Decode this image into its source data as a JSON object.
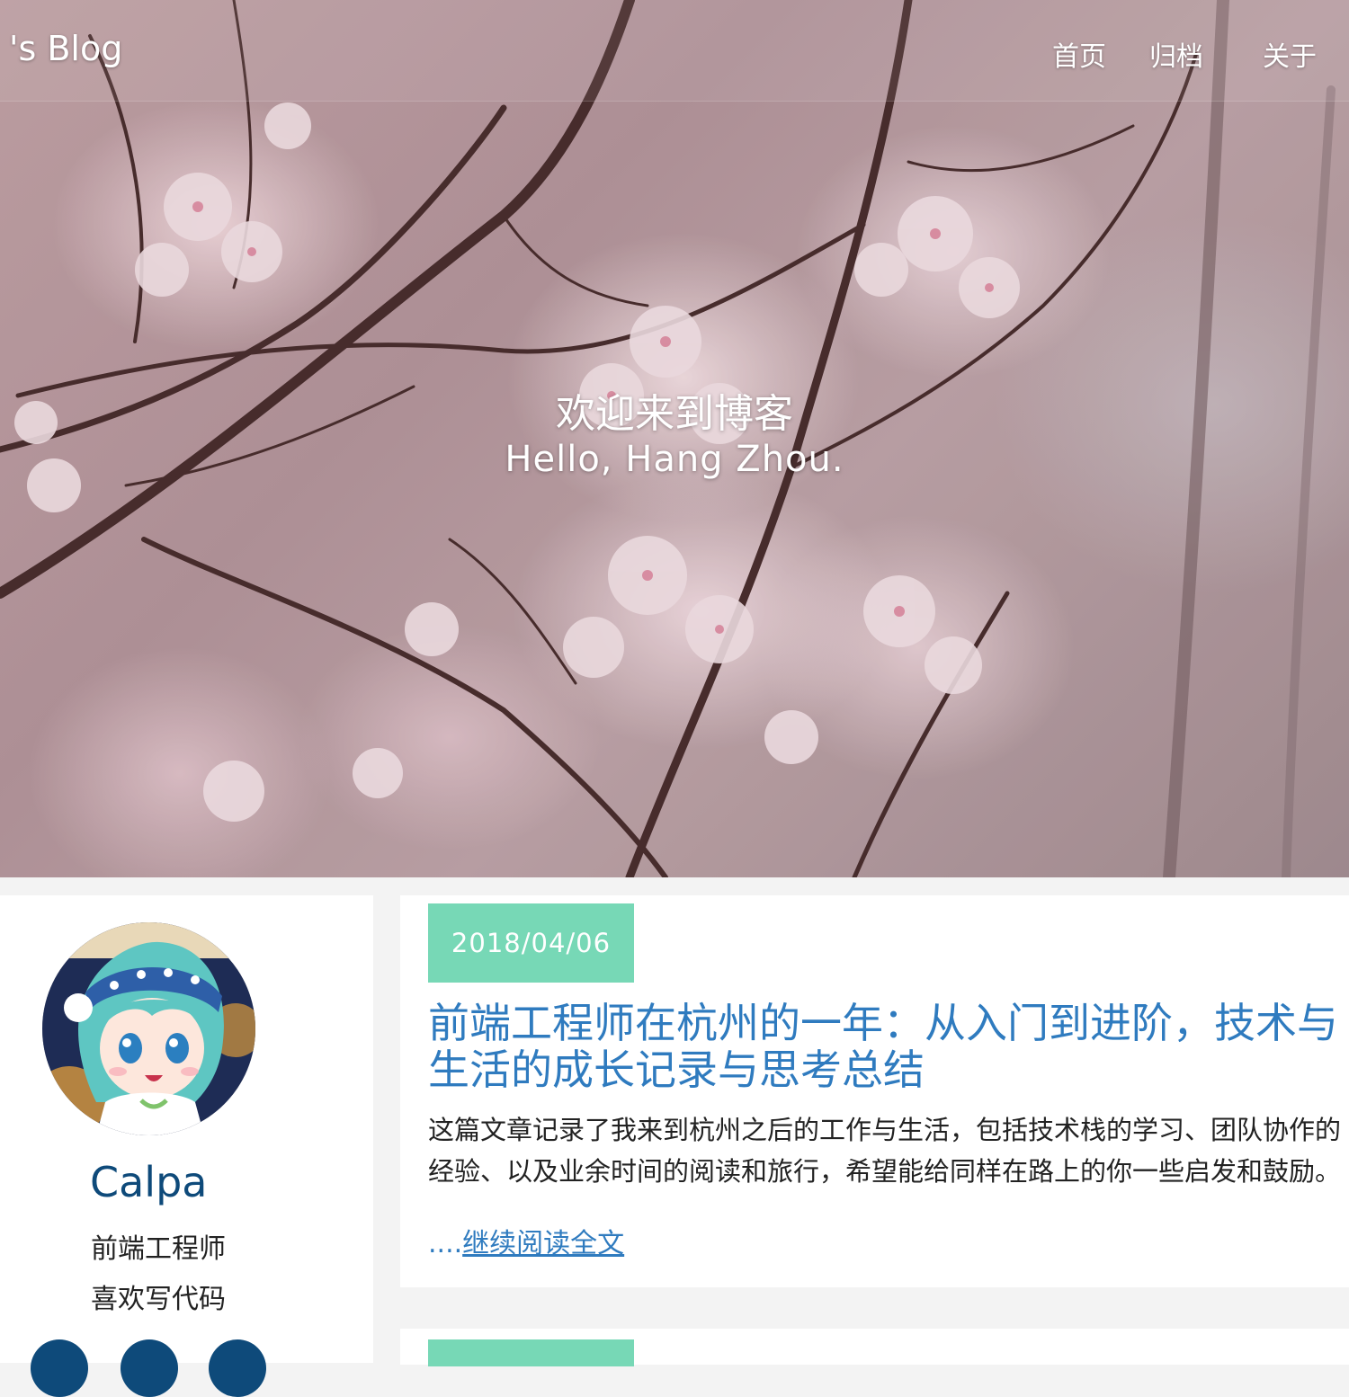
{
  "nav": {
    "brand": "'s Blog",
    "links": [
      "首页",
      "归档",
      "关于"
    ]
  },
  "hero": {
    "title": "欢迎来到博客",
    "subtitle": "Hello, Hang Zhou."
  },
  "sidebar": {
    "author_name": "Calpa",
    "bio_line_1": "前端工程师",
    "bio_line_2": "喜欢写代码",
    "social_icons": [
      "github-icon",
      "twitter-icon",
      "mail-icon"
    ]
  },
  "posts": [
    {
      "date": "2018/04/06",
      "title": "前端工程师在杭州的一年：从入门到进阶，技术与生活的成长记录与思考总结",
      "excerpt": "这篇文章记录了我来到杭州之后的工作与生活，包括技术栈的学习、团队协作的经验、以及业余时间的阅读和旅行，希望能给同样在路上的你一些启发和鼓励。",
      "read_more_prefix": "....",
      "read_more_link": "继续阅读全文"
    }
  ],
  "colors": {
    "date_badge": "#77d8b6",
    "link": "#2f7bbf",
    "author": "#0e4a7a"
  }
}
